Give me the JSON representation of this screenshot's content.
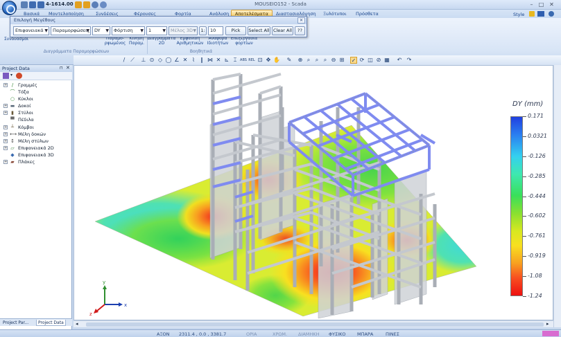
{
  "app": {
    "window_title": "MOUSEIO152 - Scada",
    "quick_access_value": "4-1614.00"
  },
  "tabs": [
    {
      "label": "Βασικά",
      "active": false
    },
    {
      "label": "Μοντελοποίηση",
      "active": false
    },
    {
      "label": "Συνδέσεις",
      "active": false
    },
    {
      "label": "Φέρουσες",
      "active": false
    },
    {
      "label": "Φορτία",
      "active": false
    },
    {
      "label": "Ανάλυση",
      "active": false
    },
    {
      "label": "Αποτελέσματα",
      "active": true
    },
    {
      "label": "Διαστασιολόγηση",
      "active": false
    },
    {
      "label": "Ξυλότυποι",
      "active": false
    },
    {
      "label": "Πρόσθετα",
      "active": false
    }
  ],
  "style_menu": "Style",
  "ribbon": {
    "left_label": "Συνδυασμοί",
    "groups": [
      {
        "caption": "Διαγράμματα Παραμορφώσεων"
      },
      {
        "caption": "Βοηθητικά"
      }
    ],
    "buttons": [
      {
        "label": "Παραμο-\nρφωμένος"
      },
      {
        "label": "Κίνηση\nΠαραμ."
      },
      {
        "label": "Διαγράμματα\n2D"
      },
      {
        "label": "Εμφάνιση\nΑριθμητικών"
      },
      {
        "label": "Αναφορά\nΙδιοτήτων"
      },
      {
        "label": "Επεξεργασία\nφορτίων"
      }
    ]
  },
  "dialog": {
    "title": "Επιλογή Μεγέθους",
    "fields": {
      "category": "Επιφανειακά",
      "quantity": "Παραμορφώσεις",
      "component": "DY",
      "case_type": "Φόρτιση",
      "case_number": "1",
      "members": "Μέλος 3D",
      "scale_label": "1:",
      "scale_value": "10"
    },
    "buttons": {
      "pick": "Pick",
      "select_all": "Select All",
      "clear_all": "Clear All",
      "help": "??"
    }
  },
  "panel": {
    "title": "Project Data",
    "tree": [
      {
        "label": "Γραμμές",
        "expandable": true,
        "icon": "line-icon",
        "color": "#3a8a3a",
        "glyph": "/"
      },
      {
        "label": "Τόξα",
        "expandable": false,
        "icon": "arc-icon",
        "color": "#3a8a3a",
        "glyph": "⌒"
      },
      {
        "label": "Κύκλοι",
        "expandable": false,
        "icon": "circle-icon",
        "color": "#3a8a3a",
        "glyph": "○"
      },
      {
        "label": "Δοκοί",
        "expandable": true,
        "icon": "beam-icon",
        "color": "#5a6a7a",
        "glyph": "▬"
      },
      {
        "label": "Στύλοι",
        "expandable": true,
        "icon": "column-icon",
        "color": "#6a5a3a",
        "glyph": "▮"
      },
      {
        "label": "Πέδιλα",
        "expandable": false,
        "icon": "footing-icon",
        "color": "#6a6a6a",
        "glyph": "▀"
      },
      {
        "label": "Κόμβοι",
        "expandable": true,
        "icon": "node-icon",
        "color": "#6a5a3a",
        "glyph": "┴"
      },
      {
        "label": "Μέλη δοκών",
        "expandable": true,
        "icon": "beam-member-icon",
        "color": "#444",
        "glyph": "⟷"
      },
      {
        "label": "Μέλη στύλων",
        "expandable": true,
        "icon": "column-member-icon",
        "color": "#444",
        "glyph": "↕"
      },
      {
        "label": "Επιφανειακά 2D",
        "expandable": true,
        "icon": "surface-2d-icon",
        "color": "#4a8a4a",
        "glyph": "▱"
      },
      {
        "label": "Επιφανειακά 3D",
        "expandable": false,
        "icon": "surface-3d-icon",
        "color": "#3a6ab0",
        "glyph": "◆"
      },
      {
        "label": "Πλάκες",
        "expandable": true,
        "icon": "slab-icon",
        "color": "#8a4a3a",
        "glyph": "▰"
      }
    ],
    "tabs": [
      "Project Par...",
      "Project Data"
    ]
  },
  "legend": {
    "title": "DY (mm)",
    "values": [
      "0.171",
      "0.0321",
      "-0.126",
      "-0.285",
      "-0.444",
      "-0.602",
      "-0.761",
      "-0.919",
      "-1.08",
      "-1.24"
    ]
  },
  "axes": {
    "x": "x",
    "y": "y",
    "z": "z"
  },
  "status": {
    "axis_label": "ΑΞΟΝ",
    "coords": "2311.4 , 0.0 , 3381.7",
    "items": [
      "ΟΡΙΑ",
      "ΧΡΩΜ.",
      "ΔΙΑΜΗΚΗ",
      "ΦΥΣΙΚΟ",
      "ΜΠΑΡΑ",
      "ΠΙΝΕΣ"
    ],
    "active_items": [
      "ΦΥΣΙΚΟ",
      "ΜΠΑΡΑ",
      "ΠΙΝΕΣ"
    ]
  },
  "colors": {
    "accent": "#f6c85a",
    "brand": "#15428b",
    "beam_gray": "#c8ccd2",
    "roof_blue": "#7f8bf0"
  }
}
